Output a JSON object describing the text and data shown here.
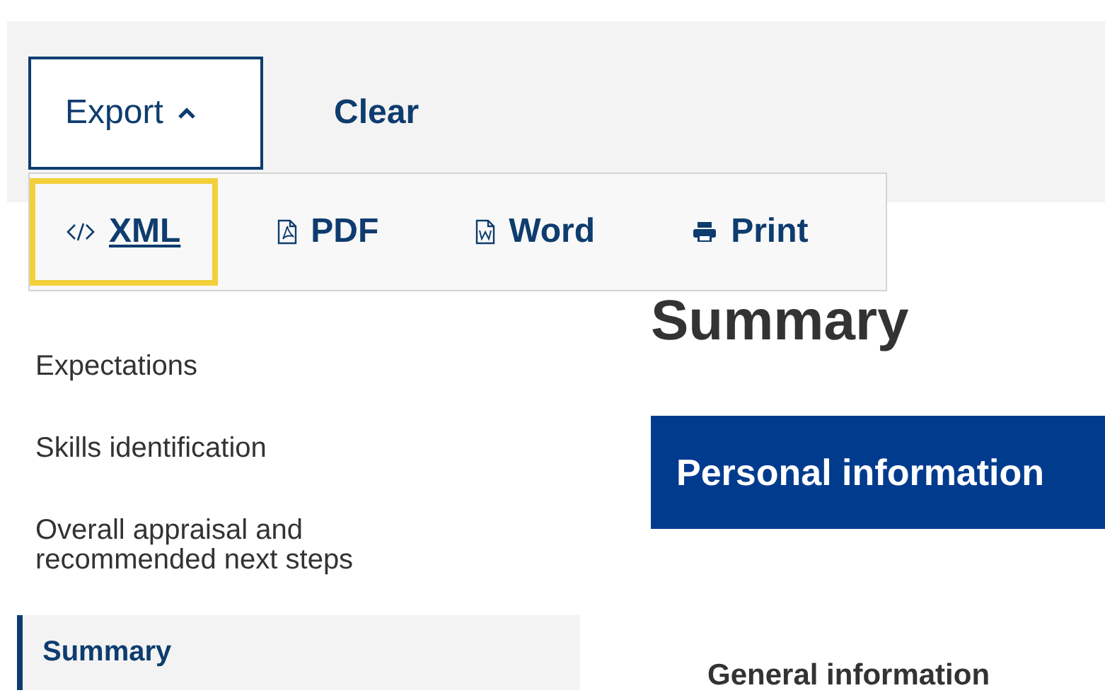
{
  "toolbar": {
    "export_button": {
      "label": "Export",
      "expanded": true
    },
    "clear_button": {
      "label": "Clear"
    }
  },
  "export_menu": [
    {
      "kind": "xml",
      "label": "XML",
      "selected": true
    },
    {
      "kind": "pdf",
      "label": "PDF",
      "selected": false
    },
    {
      "kind": "word",
      "label": "Word",
      "selected": false
    },
    {
      "kind": "print",
      "label": "Print",
      "selected": false
    }
  ],
  "sidebar": [
    {
      "label": "Expectations",
      "selected": false
    },
    {
      "label": "Skills identification",
      "selected": false
    },
    {
      "label": "Overall appraisal and\nrecommended next steps",
      "selected": false
    },
    {
      "label": "Summary",
      "selected": true
    }
  ],
  "main": {
    "heading": "Summary",
    "section_title": "Personal information",
    "subsection_title": "General information"
  }
}
